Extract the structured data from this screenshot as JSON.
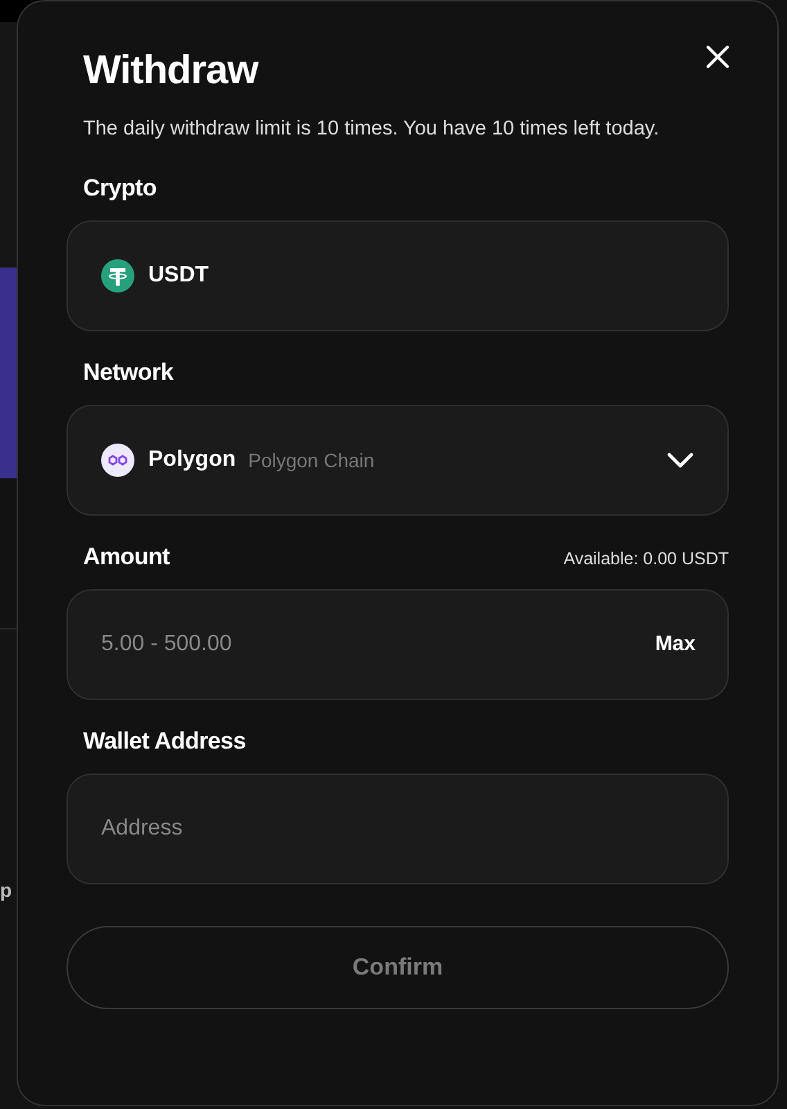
{
  "background": {
    "side_text": "p"
  },
  "dialog": {
    "title": "Withdraw",
    "notice": "The daily withdraw limit is 10 times. You have 10 times left today.",
    "fields": [
      {
        "kind": "coin",
        "label": "Crypto",
        "value": "USDT"
      },
      {
        "kind": "dropdown",
        "label": "Network",
        "value": "Polygon",
        "detail": "Polygon Chain"
      },
      {
        "kind": "amount",
        "label": "Amount",
        "note": "Available: 0.00 USDT",
        "placeholder": "5.00 - 500.00",
        "action": "Max"
      },
      {
        "kind": "text",
        "label": "Wallet Address",
        "placeholder": "Address"
      }
    ],
    "submit": {
      "label": "Confirm",
      "disabled": true
    }
  }
}
